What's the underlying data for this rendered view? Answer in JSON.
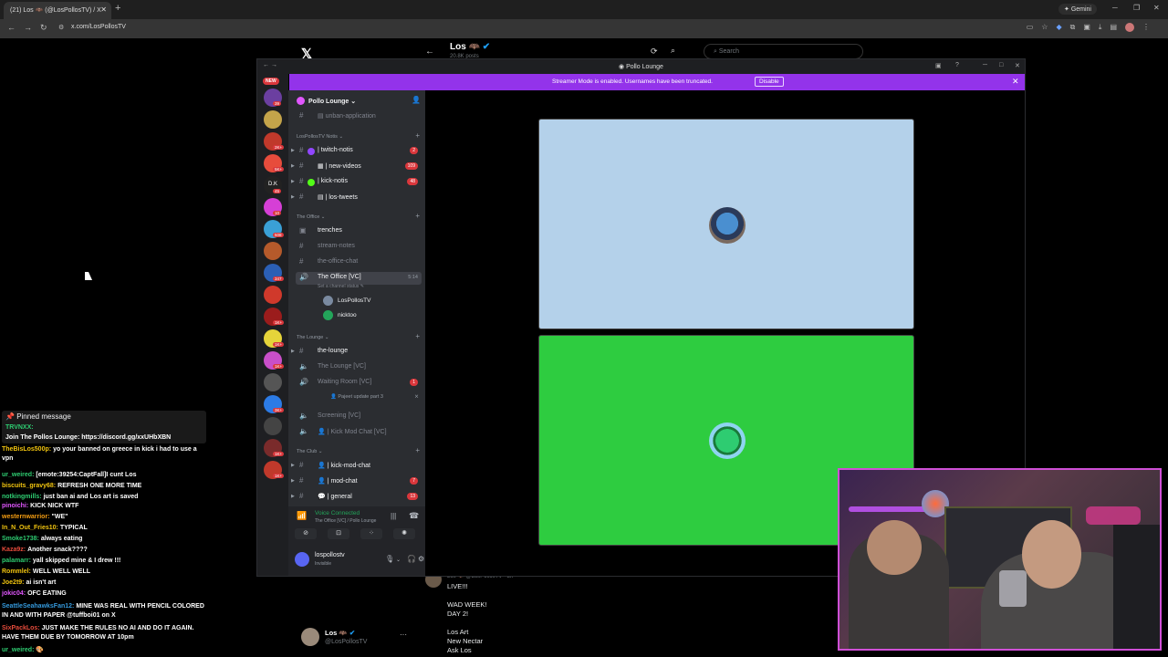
{
  "browser": {
    "tab_title": "(21) Los 🦇 (@LosPollosTV) / X",
    "new_tab": "+",
    "gemini_label": "Gemini",
    "url": "x.com/LosPollosTV"
  },
  "x": {
    "profile_name": "Los",
    "posts_count": "20.8K posts",
    "search_placeholder": "Search",
    "tweet_handle": "Los 🦇 @LosPollosTV · 3h",
    "tweet_lines": [
      "LIVE!!!",
      "",
      "WAD WEEK!",
      "DAY 2!",
      "",
      "Los Art",
      "New Nectar",
      "Ask Los"
    ],
    "account_name": "Los",
    "account_handle": "@LosPollosTV",
    "more": "···"
  },
  "discord": {
    "window_title": "Pollo Lounge",
    "banner_text": "Streamer Mode is enabled. Usernames have been truncated.",
    "banner_button": "Disable",
    "new_pill": "NEW",
    "server_name": "Pollo Lounge",
    "server_badges": [
      "39",
      "2K+",
      "5K+",
      "45",
      "10",
      "508",
      "347",
      "1K+",
      "1K+",
      "1K+",
      "3K+",
      "1K+",
      "1K+"
    ],
    "categories": {
      "notis": "LosPollosTV Notis",
      "office": "The Office",
      "lounge": "The Lounge",
      "club": "The Club"
    },
    "channels": {
      "unban": "unban-application",
      "twitch": "twitch-notis",
      "twitch_badge": "2",
      "videos": "new-videos",
      "videos_badge": "109",
      "kick": "kick-notis",
      "kick_badge": "48",
      "tweets": "los-tweets",
      "trenches": "trenches",
      "stream_notes": "stream-notes",
      "office_chat": "the-office-chat",
      "office_vc": "The Office [VC]",
      "office_vc_timer": "5:14",
      "status_hint": "Set a channel status",
      "vc_user1": "LosPollosTV",
      "vc_user2": "nicktoo",
      "the_lounge": "the-lounge",
      "lounge_vc": "The Lounge [VC]",
      "waiting_room": "Waiting Room [VC]",
      "waiting_badge": "1",
      "waiting_user": "Pajeet update part 3",
      "screening": "Screening [VC]",
      "kick_mod_vc": "Kick Mod Chat [VC]",
      "kick_mod_chat": "kick-mod-chat",
      "mod_chat": "mod-chat",
      "mod_badge": "7",
      "general": "general",
      "general_badge": "13"
    },
    "voice": {
      "title": "Voice Connected",
      "subtitle": "The Office [VC] / Pollo Lounge"
    },
    "user": {
      "name": "lospollostv",
      "status": "Invisible"
    }
  },
  "chat": {
    "pinned_title": "Pinned message",
    "pinned_user": "TRVNXX:",
    "pinned_msg": "Join The Pollos Lounge: https://discord.gg/xxUHbXBN",
    "messages": [
      {
        "user": "TheBisLos500p:",
        "color": "#f1c40f",
        "text": "yo your banned on greece in kick i had to use a vpn"
      },
      {
        "user": "ur_weired:",
        "color": "#2ecc71",
        "text": "[emote:39254:CaptFall]I cunt Los"
      },
      {
        "user": "biscuits_gravy68:",
        "color": "#f1c40f",
        "text": "REFRESH ONE MORE TIME"
      },
      {
        "user": "notkingmills:",
        "color": "#2ecc71",
        "text": "just ban ai and Los art is saved"
      },
      {
        "user": "pinoichi:",
        "color": "#e056fd",
        "text": "KICK NICK WTF"
      },
      {
        "user": "westernwarrior:",
        "color": "#f39c12",
        "text": "\"WE\""
      },
      {
        "user": "In_N_Out_Fries10:",
        "color": "#f1c40f",
        "text": "TYPICAL"
      },
      {
        "user": "Smoke1738:",
        "color": "#2ecc71",
        "text": "always eating"
      },
      {
        "user": "Kaza9z:",
        "color": "#e74c3c",
        "text": "Another snack????"
      },
      {
        "user": "palamarr:",
        "color": "#2ecc71",
        "text": "yall skipped mine & I drew !!!"
      },
      {
        "user": "Rommlel:",
        "color": "#f1c40f",
        "text": "WELL WELL WELL"
      },
      {
        "user": "Joe2t9:",
        "color": "#f1c40f",
        "text": "ai isn't art"
      },
      {
        "user": "jokic04:",
        "color": "#e056fd",
        "text": "OFC EATING"
      },
      {
        "user": "SeattleSeahawksFan12:",
        "color": "#3498db",
        "text": "MINE WAS REAL WITH PENCIL COLORED IN AND WITH PAPER @tuffboi01 on X"
      },
      {
        "user": "SixPackLos:",
        "color": "#e74c3c",
        "text": "JUST MAKE THE RULES NO AI AND DO IT AGAIN. HAVE THEM DUE BY TOMORROW AT 10pm"
      },
      {
        "user": "ur_weired:",
        "color": "#2ecc71",
        "text": "🎨"
      }
    ]
  },
  "colors": {
    "streamer_banner": "#9333ea",
    "tile_top": "#b4d1ea",
    "tile_bottom": "#2ecc40",
    "webcam_border": "#cf4fd6"
  }
}
